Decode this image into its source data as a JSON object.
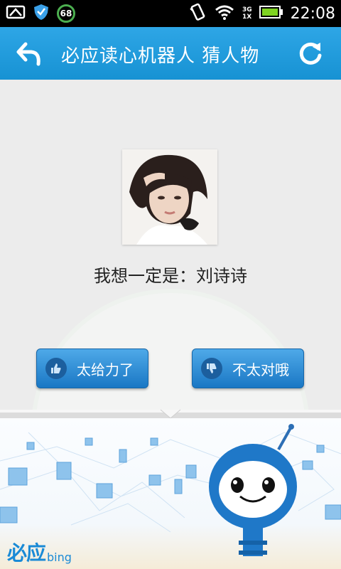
{
  "status_bar": {
    "time": "22:08",
    "badge_number": "68",
    "network_top": "3G",
    "network_bottom": "1X",
    "icons": [
      "image-icon",
      "shield-icon",
      "badge-68-icon",
      "vibrate-icon",
      "wifi-icon",
      "signal-icon",
      "battery-icon"
    ]
  },
  "header": {
    "title": "必应读心机器人  猜人物",
    "back_icon": "back-arrow-icon",
    "refresh_icon": "refresh-icon"
  },
  "main": {
    "guess_prefix": "我想一定是：",
    "guess_name": "刘诗诗",
    "buttons": {
      "yes_label": "太给力了",
      "no_label": "不太对哦",
      "yes_icon": "thumbs-up-icon",
      "no_icon": "thumbs-down-icon"
    }
  },
  "footer": {
    "logo_cn": "必应",
    "logo_en": "bing"
  },
  "colors": {
    "title_bar": "#1c98db",
    "button": "#2f8fd8",
    "background": "#ececec"
  }
}
